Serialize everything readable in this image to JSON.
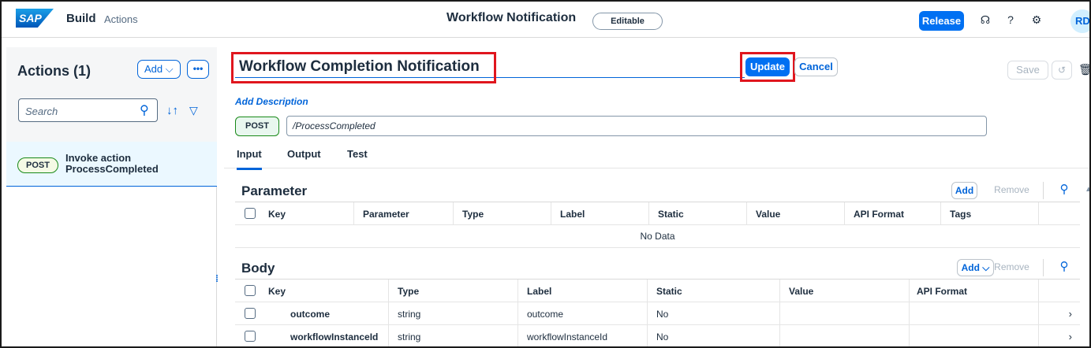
{
  "shell": {
    "logo": "SAP",
    "brand": "Build",
    "subtitle": "Actions",
    "center_title": "Workflow Notification",
    "editable_badge": "Editable",
    "release_label": "Release",
    "avatar_initials": "RD"
  },
  "left": {
    "title": "Actions (1)",
    "add_label": "Add ⌵",
    "more_label": "•••",
    "search_placeholder": "Search",
    "items": [
      {
        "method": "POST",
        "label": "Invoke action ProcessCompleted"
      }
    ]
  },
  "main": {
    "title_value": "Workflow Completion Notification",
    "update_label": "Update",
    "cancel_label": "Cancel",
    "save_label": "Save",
    "add_description": "Add Description",
    "method": "POST",
    "path": "/ProcessCompleted",
    "tabs": [
      "Input",
      "Output",
      "Test"
    ],
    "parameter": {
      "heading": "Parameter",
      "add_label": "Add",
      "remove_label": "Remove",
      "columns": [
        "Key",
        "Parameter",
        "Type",
        "Label",
        "Static",
        "Value",
        "API Format",
        "Tags"
      ],
      "empty": "No Data"
    },
    "body": {
      "heading": "Body",
      "add_label": "Add ⌵",
      "remove_label": "Remove",
      "columns": [
        "Key",
        "Type",
        "Label",
        "Static",
        "Value",
        "API Format"
      ],
      "rows": [
        {
          "key": "outcome",
          "type": "string",
          "label": "outcome",
          "static": "No"
        },
        {
          "key": "workflowInstanceId",
          "type": "string",
          "label": "workflowInstanceId",
          "static": "No"
        }
      ]
    }
  },
  "colors": {
    "accent": "#0070f2",
    "highlight": "#e0161e"
  }
}
